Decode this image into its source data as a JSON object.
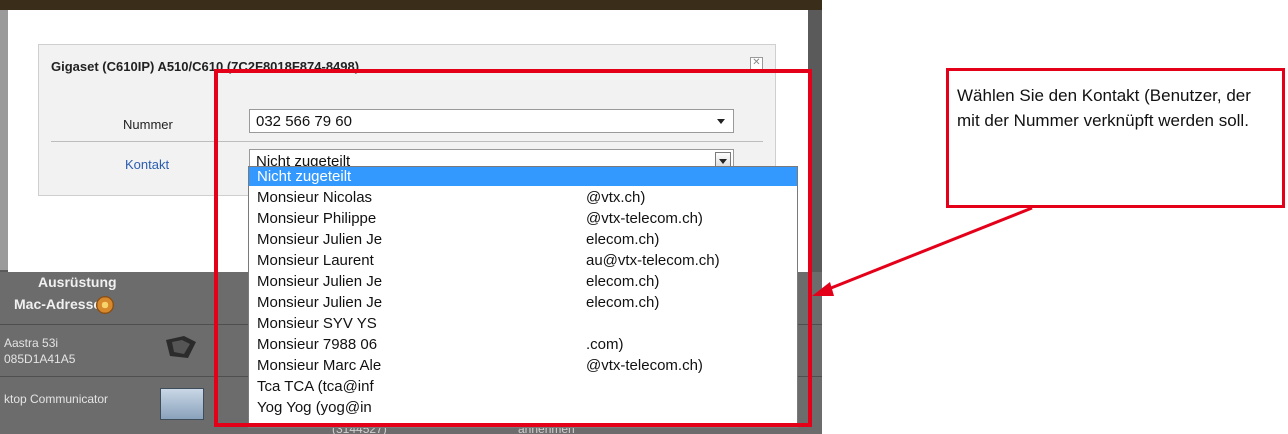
{
  "dialog": {
    "title": "Gigaset (C610IP) A510/C610 (7C2F8018F874-8498)",
    "close_glyph": "✕"
  },
  "form": {
    "nummer_label": "Nummer",
    "nummer_value": "032 566 79 60",
    "kontakt_label": "Kontakt",
    "kontakt_value": "Nicht zugeteilt"
  },
  "dropdown": {
    "items": [
      {
        "name": "Nicht zugeteilt",
        "email": "",
        "selected": true
      },
      {
        "name": "Monsieur Nicolas",
        "email": "@vtx.ch)"
      },
      {
        "name": "Monsieur Philippe",
        "email": "@vtx-telecom.ch)"
      },
      {
        "name": "Monsieur Julien Je",
        "email": "elecom.ch)"
      },
      {
        "name": "Monsieur Laurent",
        "email": "au@vtx-telecom.ch)"
      },
      {
        "name": "Monsieur Julien Je",
        "email": "elecom.ch)"
      },
      {
        "name": "Monsieur Julien Je",
        "email": "elecom.ch)"
      },
      {
        "name": "Monsieur SYV YS",
        "email": ""
      },
      {
        "name": "Monsieur 7988 06",
        "email": ".com)"
      },
      {
        "name": "Monsieur Marc Ale",
        "email": "@vtx-telecom.ch)"
      },
      {
        "name": "Tca TCA (tca@inf",
        "email": ""
      },
      {
        "name": "Yog Yog (yog@in",
        "email": ""
      }
    ]
  },
  "background": {
    "section_label": "Ausrüstung",
    "mac_label": "Mac-Adresse",
    "device1_name": "Aastra 53i",
    "device1_mac": "085D1A41A5",
    "device2_name": "ktop Communicator",
    "cut_text_1": "(3144527)",
    "cut_text_2": "annehmen"
  },
  "annotation": {
    "text": "Wählen Sie den Kontakt (Benutzer, der mit der Nummer verknüpft werden soll.",
    "color": "#e5001a"
  },
  "icons": [
    "gear-icon",
    "phone-icon",
    "desktop-communicator-icon",
    "chevron-down-icon",
    "close-icon"
  ]
}
